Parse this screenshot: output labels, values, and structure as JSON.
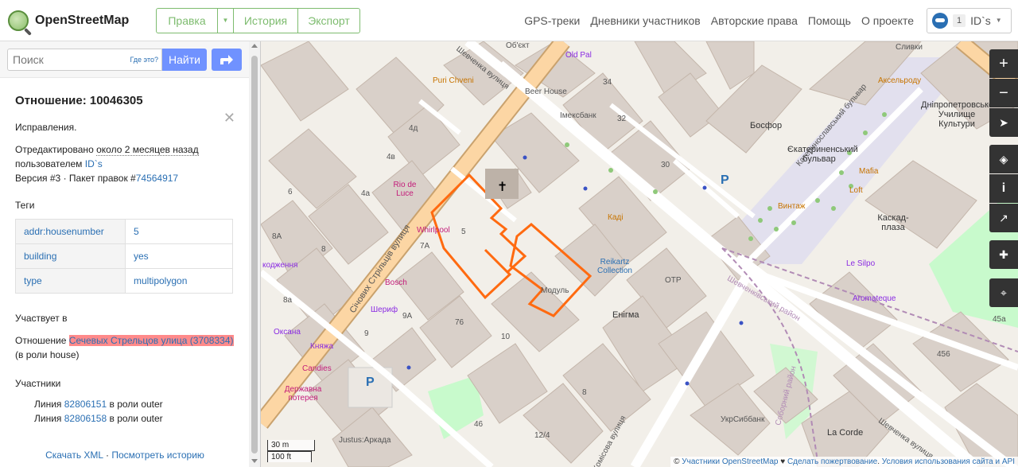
{
  "header": {
    "logo_text": "OpenStreetMap",
    "edit_label": "Правка",
    "history_label": "История",
    "export_label": "Экспорт",
    "nav": [
      "GPS-треки",
      "Дневники участников",
      "Авторские права",
      "Помощь",
      "О проекте"
    ],
    "user_count": "1",
    "user_name": "ID`s"
  },
  "search": {
    "placeholder": "Поиск",
    "where_label": "Где это?",
    "go_label": "Найти"
  },
  "relation": {
    "title": "Отношение: 10046305",
    "comment": "Исправления.",
    "edited_prefix": "Отредактировано",
    "edited_time": "около 2 месяцев назад",
    "by_prefix": "пользователем",
    "user": "ID`s",
    "version": "Версия #3 · Пакет правок #",
    "changeset": "74564917",
    "tags_heading": "Теги",
    "tags": [
      {
        "k": "addr:housenumber",
        "v": "5"
      },
      {
        "k": "building",
        "v": "yes"
      },
      {
        "k": "type",
        "v": "multipolygon"
      }
    ],
    "part_of_heading": "Участвует в",
    "part_of_prefix": "Отношение",
    "part_of_link": "Сечевых Стрельцов улица (3708334)",
    "part_of_suffix": "(в роли house)",
    "members_heading": "Участники",
    "members": [
      {
        "prefix": "Линия",
        "id": "82806151",
        "role": "в роли outer"
      },
      {
        "prefix": "Линия",
        "id": "82806158",
        "role": "в роли outer"
      }
    ],
    "download_xml": "Скачать XML",
    "sep": " · ",
    "view_history": "Посмотреть историю"
  },
  "map": {
    "labels": {
      "street1": "Січових Стрільців вулиця",
      "street2": "Шевченка вулиця",
      "street3": "Шевченківський район",
      "street4": "Соборний район",
      "street5": "Шевченка вулиця",
      "street6": "Комісова вулиця",
      "boulevard": "Катеринославський бульвар",
      "bosfor": "Босфор",
      "ekat": "Єкатериненський бульвар",
      "kaskad": "Каскад-плаза",
      "dnipro": "Дніпропетровське Училище Культури",
      "enigma": "Енігма",
      "beerhouse": "Beer House",
      "imexbank": "Імексбанк",
      "puri": "Puri Chveni",
      "oldpal": "Old Pal",
      "riode": "Rio de Luce",
      "whirlpool": "Whirlpool",
      "bosch": "Bosch",
      "sherif": "Шериф",
      "candies": "Candies",
      "kadi": "Каді",
      "reikartz": "Reikartz Collection",
      "otp": "ОТР",
      "modul": "Модуль",
      "mafia": "Mafia",
      "loft": "Loft",
      "vintazh": "Винтаж",
      "lesilpo": "Le Silpo",
      "aromateque": "Aromateque",
      "ukrsib": "УкрСиббанк",
      "lacorde": "La Corde",
      "justus": "Justus:Аркада",
      "oksana": "Оксана",
      "knyazha": "Княжа",
      "derzhavna": "Державна потерея",
      "axelrod": "Аксельроду",
      "slivki": "Сливки",
      "obekt": "Об'єкт",
      "kohzennia": "кодження"
    },
    "numbers": [
      "4д",
      "4в",
      "4а",
      "6",
      "8А",
      "8",
      "7А",
      "5",
      "76",
      "9А",
      "9",
      "10",
      "8а",
      "34",
      "32",
      "30",
      "8",
      "46",
      "12/4",
      "456",
      "45а"
    ],
    "scale_m": "30 m",
    "scale_ft": "100 ft",
    "attribution_prefix": "© ",
    "attribution_link1": "Участники OpenStreetMap",
    "attribution_heart": " ♥ ",
    "attribution_link2": "Сделать пожертвование",
    "attribution_sep": ". ",
    "attribution_link3": "Условия использования сайта и API"
  },
  "colors": {
    "accent": "#7ebc6f",
    "link": "#2a6fb3",
    "button": "#7092ff",
    "highlight": "#ff8a8a",
    "relation_outline": "#ff6a10"
  }
}
